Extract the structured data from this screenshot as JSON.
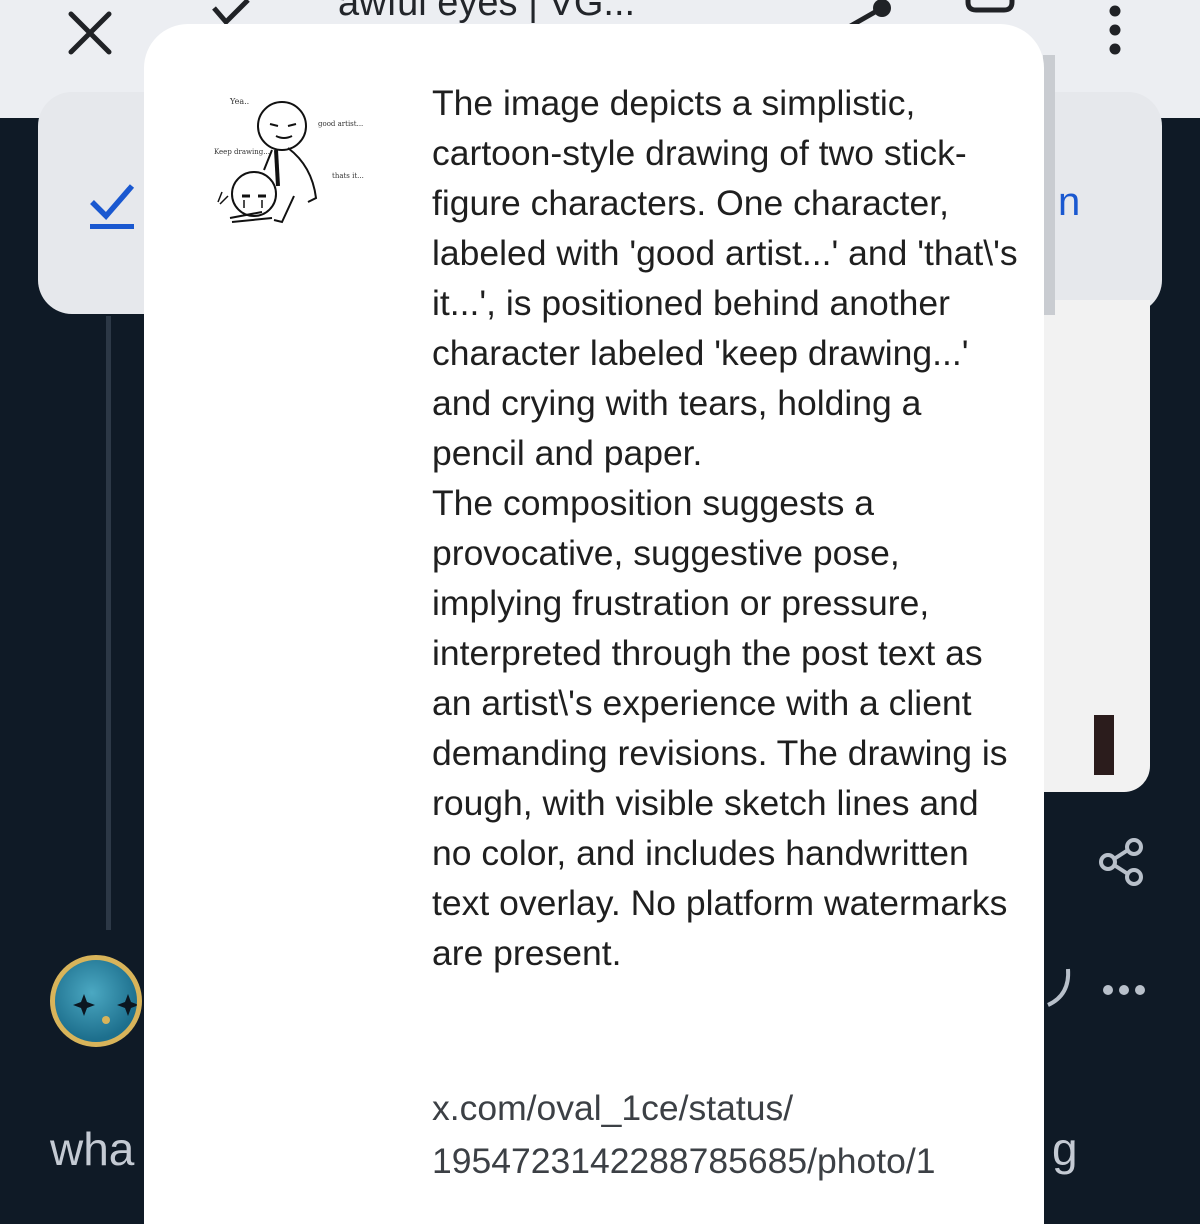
{
  "browser": {
    "title": "awful eyes | VG...",
    "close_icon": "close-icon",
    "share_icon": "share-icon",
    "bookmark_icon": "bookmark-icon",
    "more_icon": "more-vert-icon"
  },
  "background": {
    "partial_button_text": "n",
    "left_text_fragment": "wha",
    "right_text_fragment": "g"
  },
  "modal": {
    "thumbnail": {
      "labels": [
        "Yea..",
        "good artist...",
        "Keep drawing....",
        "thats it..."
      ]
    },
    "description": "The image depicts a simplistic, cartoon-style drawing of two stick-figure characters. One character, labeled with 'good artist...' and 'that\\'s it...', is positioned behind another character labeled 'keep drawing...' and crying with tears, holding a pencil and paper.\nThe composition suggests a provocative, suggestive pose, implying frustration or pressure, interpreted through the post text as an artist\\'s experience with a client demanding revisions. The drawing is rough, with visible sketch lines and no color, and includes handwritten text overlay. No platform watermarks are present.",
    "source_line1": "x.com/oval_1ce/status/",
    "source_line2": "1954723142288785685/photo/1"
  },
  "colors": {
    "page_bg": "#0f1a26",
    "topbar_bg": "#eceef2",
    "modal_bg": "#ffffff",
    "accent_blue": "#1a58d0",
    "avatar_border": "#d8b45a"
  }
}
